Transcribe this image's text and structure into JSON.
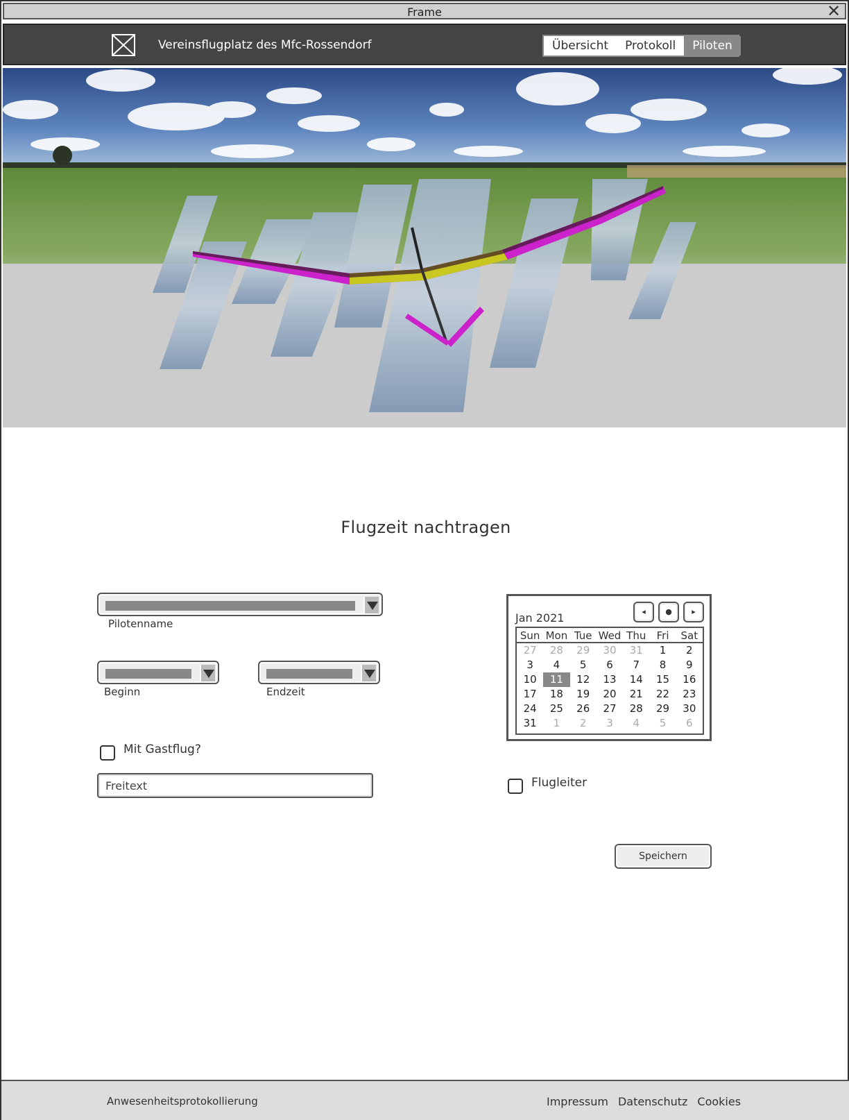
{
  "window": {
    "title": "Frame"
  },
  "header": {
    "site_title": "Vereinsflugplatz des Mfc-Rossendorf",
    "tabs": [
      {
        "label": "Übersicht",
        "active": false
      },
      {
        "label": "Protokoll",
        "active": false
      },
      {
        "label": "Piloten",
        "active": true
      }
    ]
  },
  "hero": {
    "description_icon": "image-placeholder-icon"
  },
  "main": {
    "heading": "Flugzeit nachtragen",
    "pilot_label": "Pilotenname",
    "begin_label": "Beginn",
    "end_label": "Endzeit",
    "guest_flight_label": "Mit Gastflug?",
    "freitext_value": "Freitext",
    "flight_director_label": "Flugleiter",
    "save_label": "Speichern"
  },
  "calendar": {
    "month": "Jan 2021",
    "prev": "◂",
    "today": "●",
    "next": "▸",
    "weekdays": [
      "Sun",
      "Mon",
      "Tue",
      "Wed",
      "Thu",
      "Fri",
      "Sat"
    ],
    "weeks": [
      [
        "27",
        "28",
        "29",
        "30",
        "31",
        "1",
        "2"
      ],
      [
        "3",
        "4",
        "5",
        "6",
        "7",
        "8",
        "9"
      ],
      [
        "10",
        "11",
        "12",
        "13",
        "14",
        "15",
        "16"
      ],
      [
        "17",
        "18",
        "19",
        "20",
        "21",
        "22",
        "23"
      ],
      [
        "24",
        "25",
        "26",
        "27",
        "28",
        "29",
        "30"
      ],
      [
        "31",
        "1",
        "2",
        "3",
        "4",
        "5",
        "6"
      ]
    ],
    "selected": "11"
  },
  "footer": {
    "left": "Anwesenheitsprotokollierung",
    "links": [
      "Impressum",
      "Datenschutz",
      "Cookies"
    ]
  },
  "colors": {
    "header_bg": "#444444",
    "tab_active_bg": "#888888",
    "wing_magenta": "#cc22cc",
    "wing_yellow": "#c8c820"
  }
}
